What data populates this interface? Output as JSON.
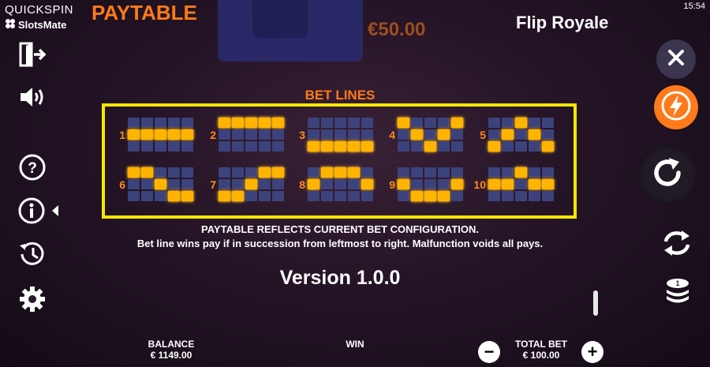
{
  "header": {
    "brand": "QUICKSPIN",
    "brand2": "SlotsMate",
    "paytable_title": "PAYTABLE",
    "game_title": "Flip Royale",
    "clock": "15:54",
    "top_prize": "€50.00"
  },
  "left_toolbar": {
    "icons": [
      "exit-icon",
      "sound-icon",
      "help-icon",
      "info-icon",
      "history-icon",
      "settings-icon"
    ]
  },
  "bet_lines": {
    "title": "BET LINES",
    "lines": [
      {
        "number": "1",
        "pattern": [
          1,
          1,
          1,
          1,
          1
        ]
      },
      {
        "number": "2",
        "pattern": [
          0,
          0,
          0,
          0,
          0
        ]
      },
      {
        "number": "3",
        "pattern": [
          2,
          2,
          2,
          2,
          2
        ]
      },
      {
        "number": "4",
        "pattern": [
          0,
          1,
          2,
          1,
          0
        ]
      },
      {
        "number": "5",
        "pattern": [
          2,
          1,
          0,
          1,
          2
        ]
      },
      {
        "number": "6",
        "pattern": [
          0,
          0,
          1,
          2,
          2
        ]
      },
      {
        "number": "7",
        "pattern": [
          2,
          2,
          1,
          0,
          0
        ]
      },
      {
        "number": "8",
        "pattern": [
          1,
          0,
          0,
          0,
          1
        ]
      },
      {
        "number": "9",
        "pattern": [
          1,
          2,
          2,
          2,
          1
        ]
      },
      {
        "number": "10",
        "pattern": [
          1,
          1,
          0,
          1,
          1
        ]
      }
    ]
  },
  "info": {
    "line1": "PAYTABLE REFLECTS CURRENT BET CONFIGURATION.",
    "line2": "Bet line wins pay if in succession from leftmost to right. Malfunction voids all pays.",
    "version": "Version 1.0.0"
  },
  "footer": {
    "balance_label": "BALANCE",
    "balance_value": "€ 1149.00",
    "win_label": "WIN",
    "total_bet_label": "TOTAL BET",
    "total_bet_value": "€ 100.00",
    "minus": "−",
    "plus": "+"
  },
  "colors": {
    "accent_orange": "#ff7a1a",
    "highlight_yellow": "#f5e600",
    "lit_cell": "#ffb400",
    "unlit_cell": "#3c437c"
  }
}
